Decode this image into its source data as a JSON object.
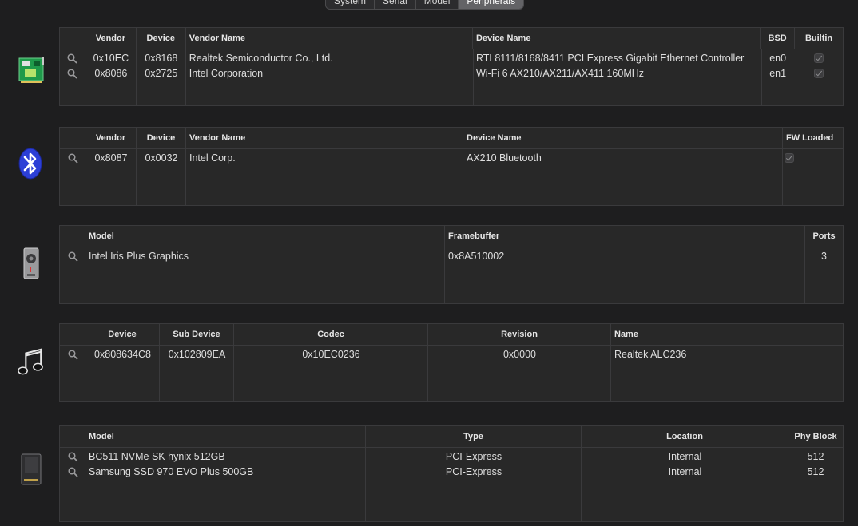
{
  "tabs": [
    {
      "label": "System"
    },
    {
      "label": "Serial"
    },
    {
      "label": "Model"
    },
    {
      "label": "Peripherals",
      "active": true
    }
  ],
  "network": {
    "headers": [
      "",
      "Vendor",
      "Device",
      "Vendor Name",
      "Device Name",
      "BSD",
      "Builtin"
    ],
    "rows": [
      {
        "vendor": "0x10EC",
        "device": "0x8168",
        "vendor_name": "Realtek Semiconductor Co., Ltd.",
        "device_name": "RTL8111/8168/8411 PCI Express Gigabit Ethernet Controller",
        "bsd": "en0",
        "builtin": true
      },
      {
        "vendor": "0x8086",
        "device": "0x2725",
        "vendor_name": "Intel Corporation",
        "device_name": "Wi-Fi 6 AX210/AX211/AX411 160MHz",
        "bsd": "en1",
        "builtin": true
      }
    ]
  },
  "bluetooth": {
    "headers": [
      "",
      "Vendor",
      "Device",
      "Vendor Name",
      "Device Name",
      "FW Loaded"
    ],
    "rows": [
      {
        "vendor": "0x8087",
        "device": "0x0032",
        "vendor_name": "Intel Corp.",
        "device_name": "AX210 Bluetooth",
        "fw_loaded": true
      }
    ]
  },
  "graphics": {
    "headers": [
      "",
      "Model",
      "Framebuffer",
      "Ports"
    ],
    "rows": [
      {
        "model": "Intel Iris Plus Graphics",
        "framebuffer": "0x8A510002",
        "ports": "3"
      }
    ]
  },
  "audio": {
    "headers": [
      "",
      "Device",
      "Sub Device",
      "Codec",
      "Revision",
      "Name"
    ],
    "rows": [
      {
        "device": "0x808634C8",
        "sub_device": "0x102809EA",
        "codec": "0x10EC0236",
        "revision": "0x0000",
        "name": "Realtek ALC236"
      }
    ]
  },
  "storage": {
    "headers": [
      "",
      "Model",
      "Type",
      "Location",
      "Phy Block"
    ],
    "rows": [
      {
        "model": "BC511 NVMe SK hynix 512GB",
        "type": "PCI-Express",
        "location": "Internal",
        "phy_block": "512"
      },
      {
        "model": "Samsung SSD 970 EVO Plus 500GB",
        "type": "PCI-Express",
        "location": "Internal",
        "phy_block": "512"
      }
    ]
  },
  "icons": [
    "network-card-icon",
    "bluetooth-icon",
    "graphics-card-icon",
    "music-notes-icon",
    "ssd-icon",
    "magnifier-icon"
  ],
  "colors": {
    "background": "#1e1e1f",
    "panel": "#282828",
    "border": "#3a3a3c",
    "bluetooth": "#2c3fd6",
    "pcb_green": "#1f9a4a"
  }
}
